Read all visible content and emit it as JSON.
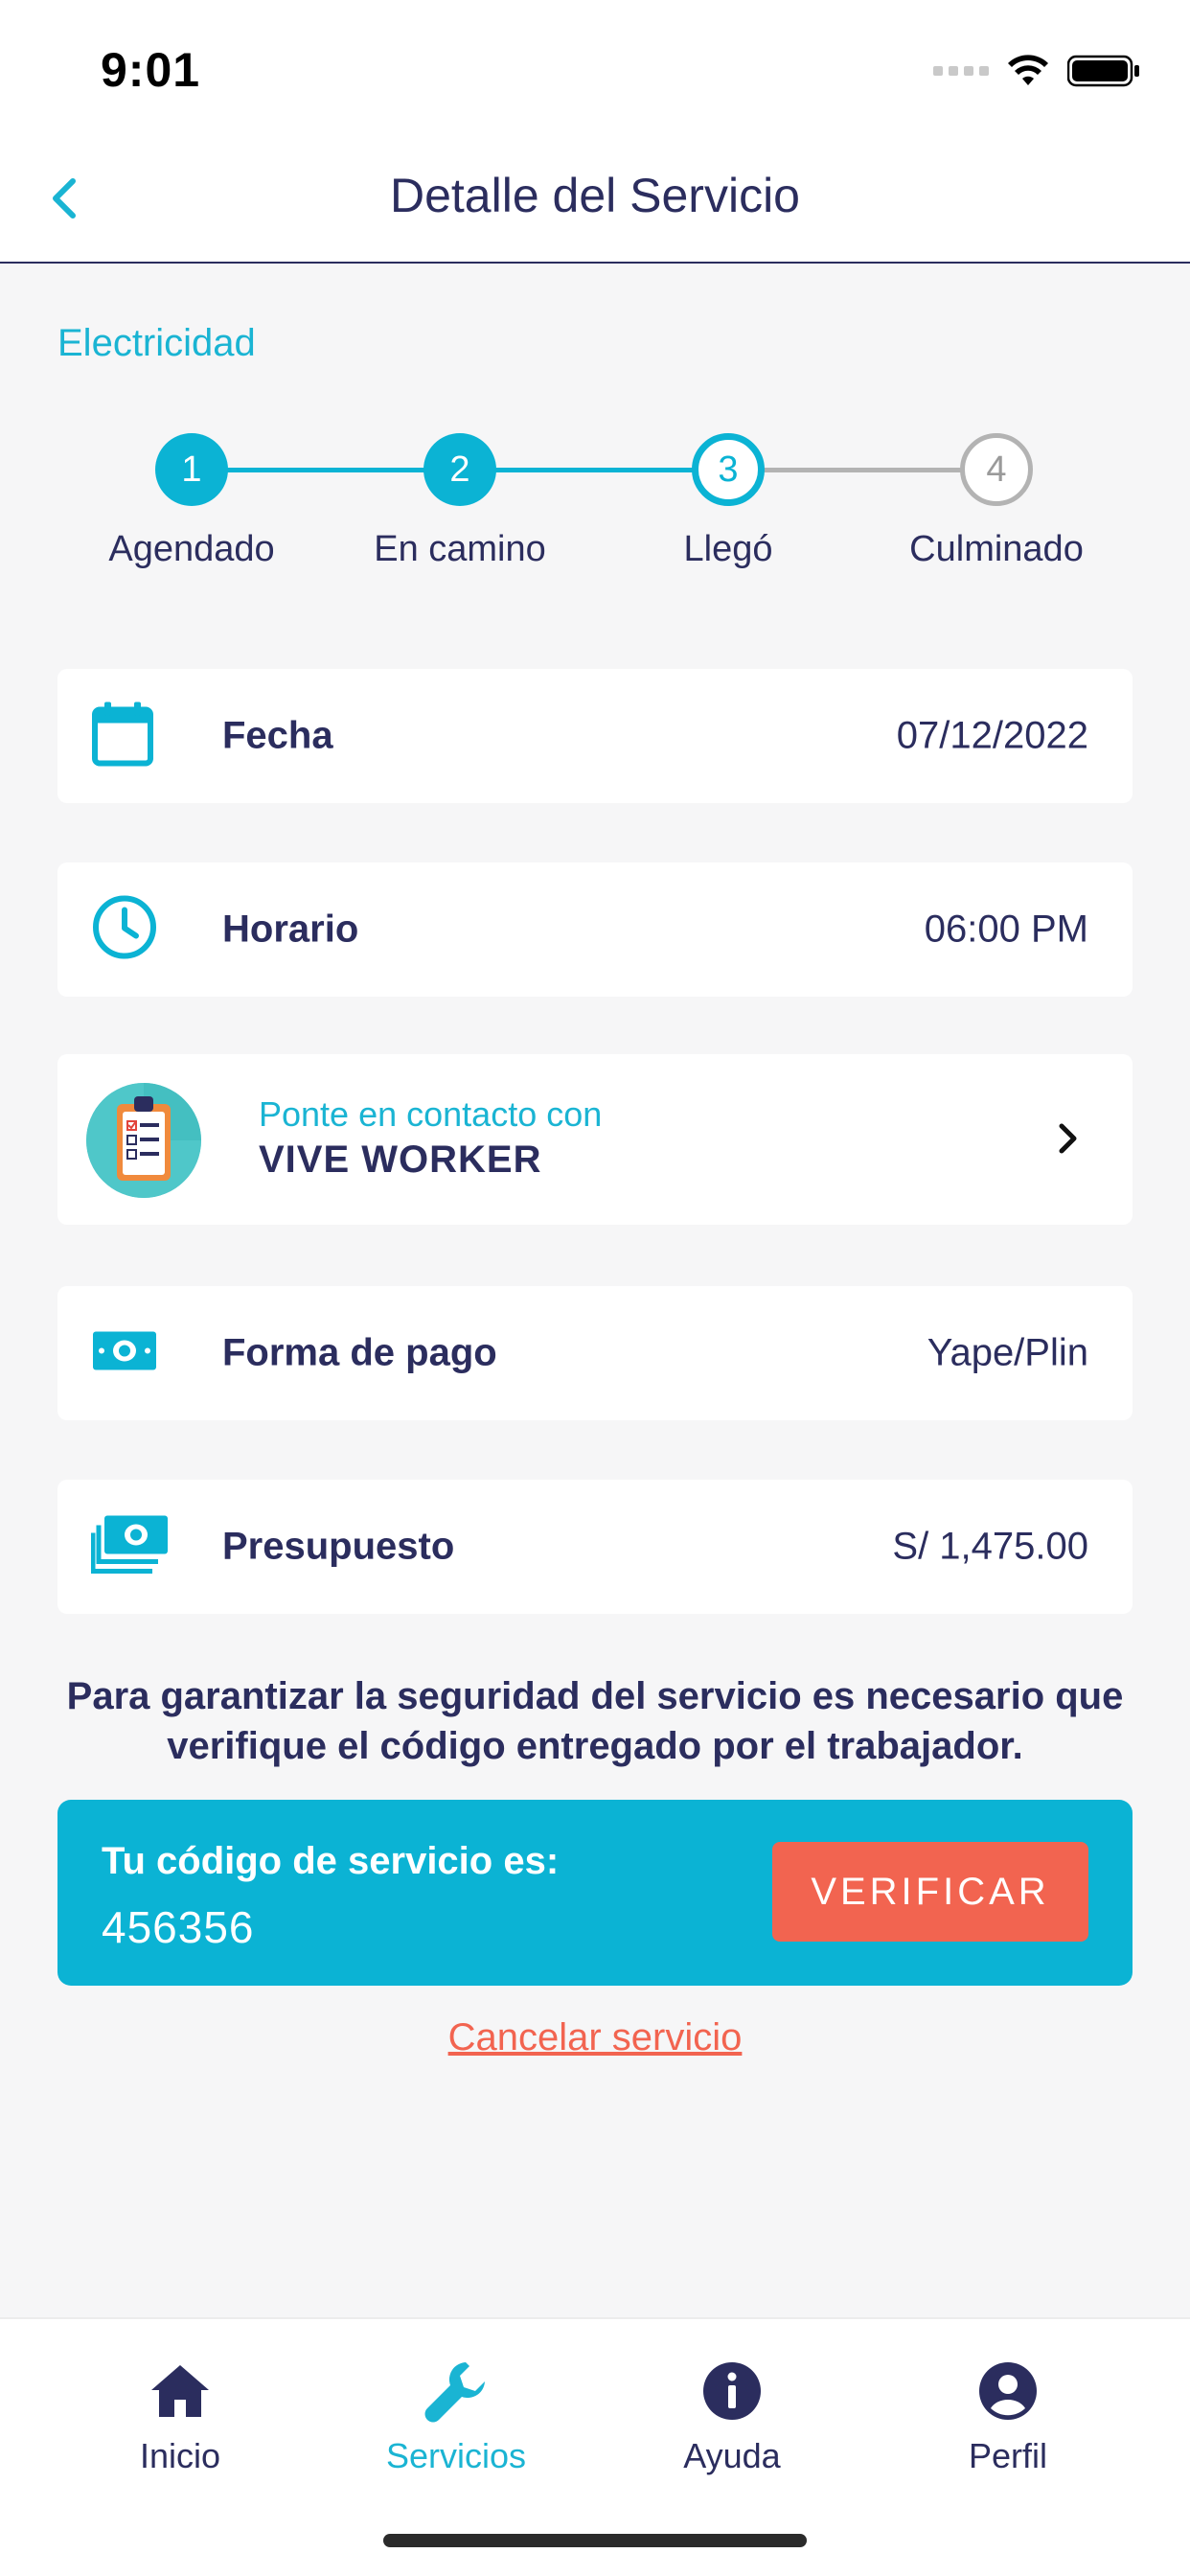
{
  "status_bar": {
    "time": "9:01"
  },
  "header": {
    "title": "Detalle del Servicio"
  },
  "category": "Electricidad",
  "stepper": {
    "steps": [
      {
        "number": "1",
        "label": "Agendado",
        "state": "done"
      },
      {
        "number": "2",
        "label": "En camino",
        "state": "done"
      },
      {
        "number": "3",
        "label": "Llegó",
        "state": "current"
      },
      {
        "number": "4",
        "label": "Culminado",
        "state": "todo"
      }
    ]
  },
  "details": {
    "fecha": {
      "label": "Fecha",
      "value": "07/12/2022",
      "icon": "calendar-icon"
    },
    "horario": {
      "label": "Horario",
      "value": "06:00 PM",
      "icon": "clock-icon"
    },
    "contact": {
      "subtitle": "Ponte en contacto con",
      "name": "VIVE WORKER",
      "icon": "clipboard-avatar"
    },
    "pago": {
      "label": "Forma de pago",
      "value": "Yape/Plin",
      "icon": "cash-icon"
    },
    "presupuesto": {
      "label": "Presupuesto",
      "value": "S/ 1,475.00",
      "icon": "money-stack-icon"
    }
  },
  "notice": "Para garantizar la seguridad del servicio es necesario que verifique el código entregado por el trabajador.",
  "service_code": {
    "label": "Tu código de servicio es:",
    "value": "456356",
    "button": "VERIFICAR"
  },
  "cancel_label": "Cancelar servicio",
  "tabbar": {
    "items": [
      {
        "label": "Inicio",
        "icon": "home-icon",
        "active": false
      },
      {
        "label": "Servicios",
        "icon": "wrench-icon",
        "active": true
      },
      {
        "label": "Ayuda",
        "icon": "info-icon",
        "active": false
      },
      {
        "label": "Perfil",
        "icon": "profile-icon",
        "active": false
      }
    ]
  },
  "colors": {
    "accent": "#0bb3d4",
    "navy": "#2b2d5e",
    "danger": "#f26450",
    "background": "#f6f6f7"
  }
}
